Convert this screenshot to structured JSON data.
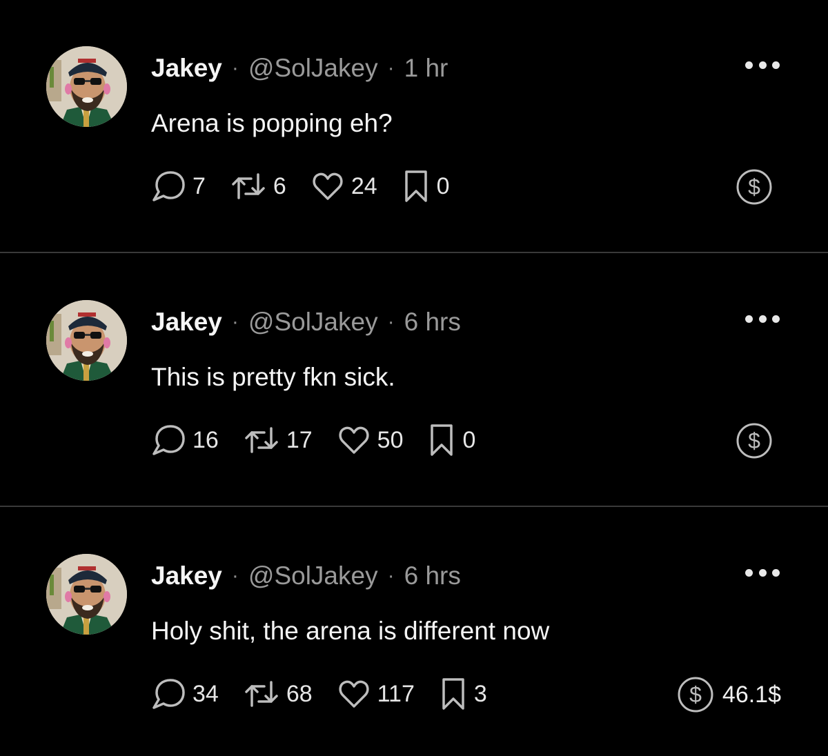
{
  "posts": [
    {
      "author": "Jakey",
      "handle": "@SolJakey",
      "time": "1 hr",
      "text": "Arena is popping eh?",
      "replies": "7",
      "reposts": "6",
      "likes": "24",
      "bookmarks": "0",
      "tip_amount": ""
    },
    {
      "author": "Jakey",
      "handle": "@SolJakey",
      "time": "6 hrs",
      "text": "This is pretty fkn sick.",
      "replies": "16",
      "reposts": "17",
      "likes": "50",
      "bookmarks": "0",
      "tip_amount": ""
    },
    {
      "author": "Jakey",
      "handle": "@SolJakey",
      "time": "6 hrs",
      "text": "Holy shit, the arena is different now",
      "replies": "34",
      "reposts": "68",
      "likes": "117",
      "bookmarks": "3",
      "tip_amount": "46.1$"
    }
  ],
  "separator": "·",
  "icons": {
    "reply": "speech-bubble-icon",
    "repost": "repost-arrows-icon",
    "like": "heart-icon",
    "bookmark": "bookmark-icon",
    "tip": "dollar-coin-icon",
    "more": "more-dots-icon"
  },
  "colors": {
    "background": "#000000",
    "primary_text": "#f5f5f5",
    "secondary_text": "#9a9a9a",
    "divider": "#3a3a3a"
  }
}
